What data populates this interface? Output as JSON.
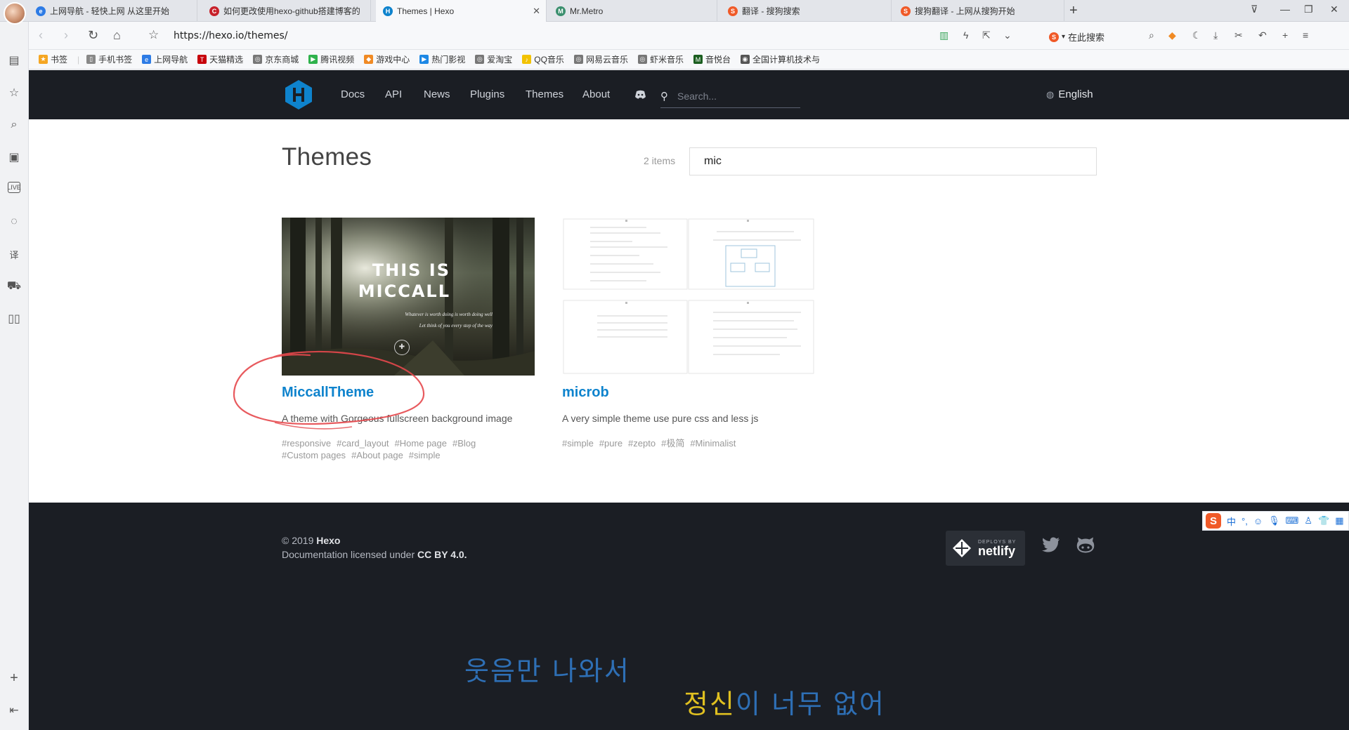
{
  "tabs": [
    {
      "title": "上网导航 - 轻快上网 从这里开始",
      "fav_color": "#2d7be5",
      "fav_glyph": "e"
    },
    {
      "title": "如何更改使用hexo-github搭建博客的",
      "fav_color": "#c7212a",
      "fav_glyph": "C"
    },
    {
      "title": "Themes | Hexo",
      "fav_color": "#0e83cd",
      "fav_glyph": "H"
    },
    {
      "title": "Mr.Metro",
      "fav_color": "#3b8f6e",
      "fav_glyph": "M"
    },
    {
      "title": "翻译 - 搜狗搜索",
      "fav_color": "#f05a28",
      "fav_glyph": "S"
    },
    {
      "title": "搜狗翻译 - 上网从搜狗开始",
      "fav_color": "#f05a28",
      "fav_glyph": "S"
    }
  ],
  "address": {
    "url": "https://hexo.io/themes/",
    "search_placeholder": "在此搜索"
  },
  "bookmarks": [
    {
      "label": "书签",
      "color": "#f5a623",
      "glyph": "★"
    },
    {
      "label": "手机书签",
      "color": "#888888",
      "glyph": "▯"
    },
    {
      "label": "上网导航",
      "color": "#2d7be5",
      "glyph": "e"
    },
    {
      "label": "天猫精选",
      "color": "#c7000b",
      "glyph": "T"
    },
    {
      "label": "京东商城",
      "color": "#777777",
      "glyph": "◎"
    },
    {
      "label": "腾讯视频",
      "color": "#2fb24c",
      "glyph": "▶"
    },
    {
      "label": "游戏中心",
      "color": "#f08a24",
      "glyph": "◆"
    },
    {
      "label": "热门影视",
      "color": "#1e88e5",
      "glyph": "▶"
    },
    {
      "label": "爱淘宝",
      "color": "#777777",
      "glyph": "◎"
    },
    {
      "label": "QQ音乐",
      "color": "#f2c200",
      "glyph": "♪"
    },
    {
      "label": "网易云音乐",
      "color": "#777777",
      "glyph": "◎"
    },
    {
      "label": "虾米音乐",
      "color": "#777777",
      "glyph": "◎"
    },
    {
      "label": "音悦台",
      "color": "#1b5e20",
      "glyph": "M"
    },
    {
      "label": "全国计算机技术与",
      "color": "#555555",
      "glyph": "◉"
    }
  ],
  "site": {
    "nav": [
      "Docs",
      "API",
      "News",
      "Plugins",
      "Themes",
      "About"
    ],
    "search_placeholder": "Search...",
    "language": "English",
    "accent": "#0e83cd"
  },
  "themes_page": {
    "title": "Themes",
    "count": "2 items",
    "filter_value": "mic"
  },
  "cards": [
    {
      "name": "MiccallTheme",
      "description": "A theme with Gorgeous fullscreen background image",
      "tags": [
        "#responsive",
        "#card_layout",
        "#Home page",
        "#Blog",
        "#Custom pages",
        "#About page",
        "#simple"
      ],
      "preview_line1": "THIS IS",
      "preview_line2": "MICCALL",
      "preview_sub1": "Whatever is worth doing is worth doing well",
      "preview_sub2": "Let think of you every step of the way"
    },
    {
      "name": "microb",
      "description": "A very simple theme use pure css and less js",
      "tags": [
        "#simple",
        "#pure",
        "#zepto",
        "#极简",
        "#Minimalist"
      ]
    }
  ],
  "footer": {
    "year": "© 2019",
    "brand": "Hexo",
    "license_prefix": "Documentation licensed under",
    "license": "CC BY 4.0.",
    "netlify_small": "DEPLOYS BY",
    "netlify_big": "netlify"
  },
  "lyrics": {
    "line1": "웃음만 나와서",
    "line2_highlight": "정신",
    "line2_rest": "이 너무 없어"
  },
  "ime": {
    "label": "中"
  }
}
